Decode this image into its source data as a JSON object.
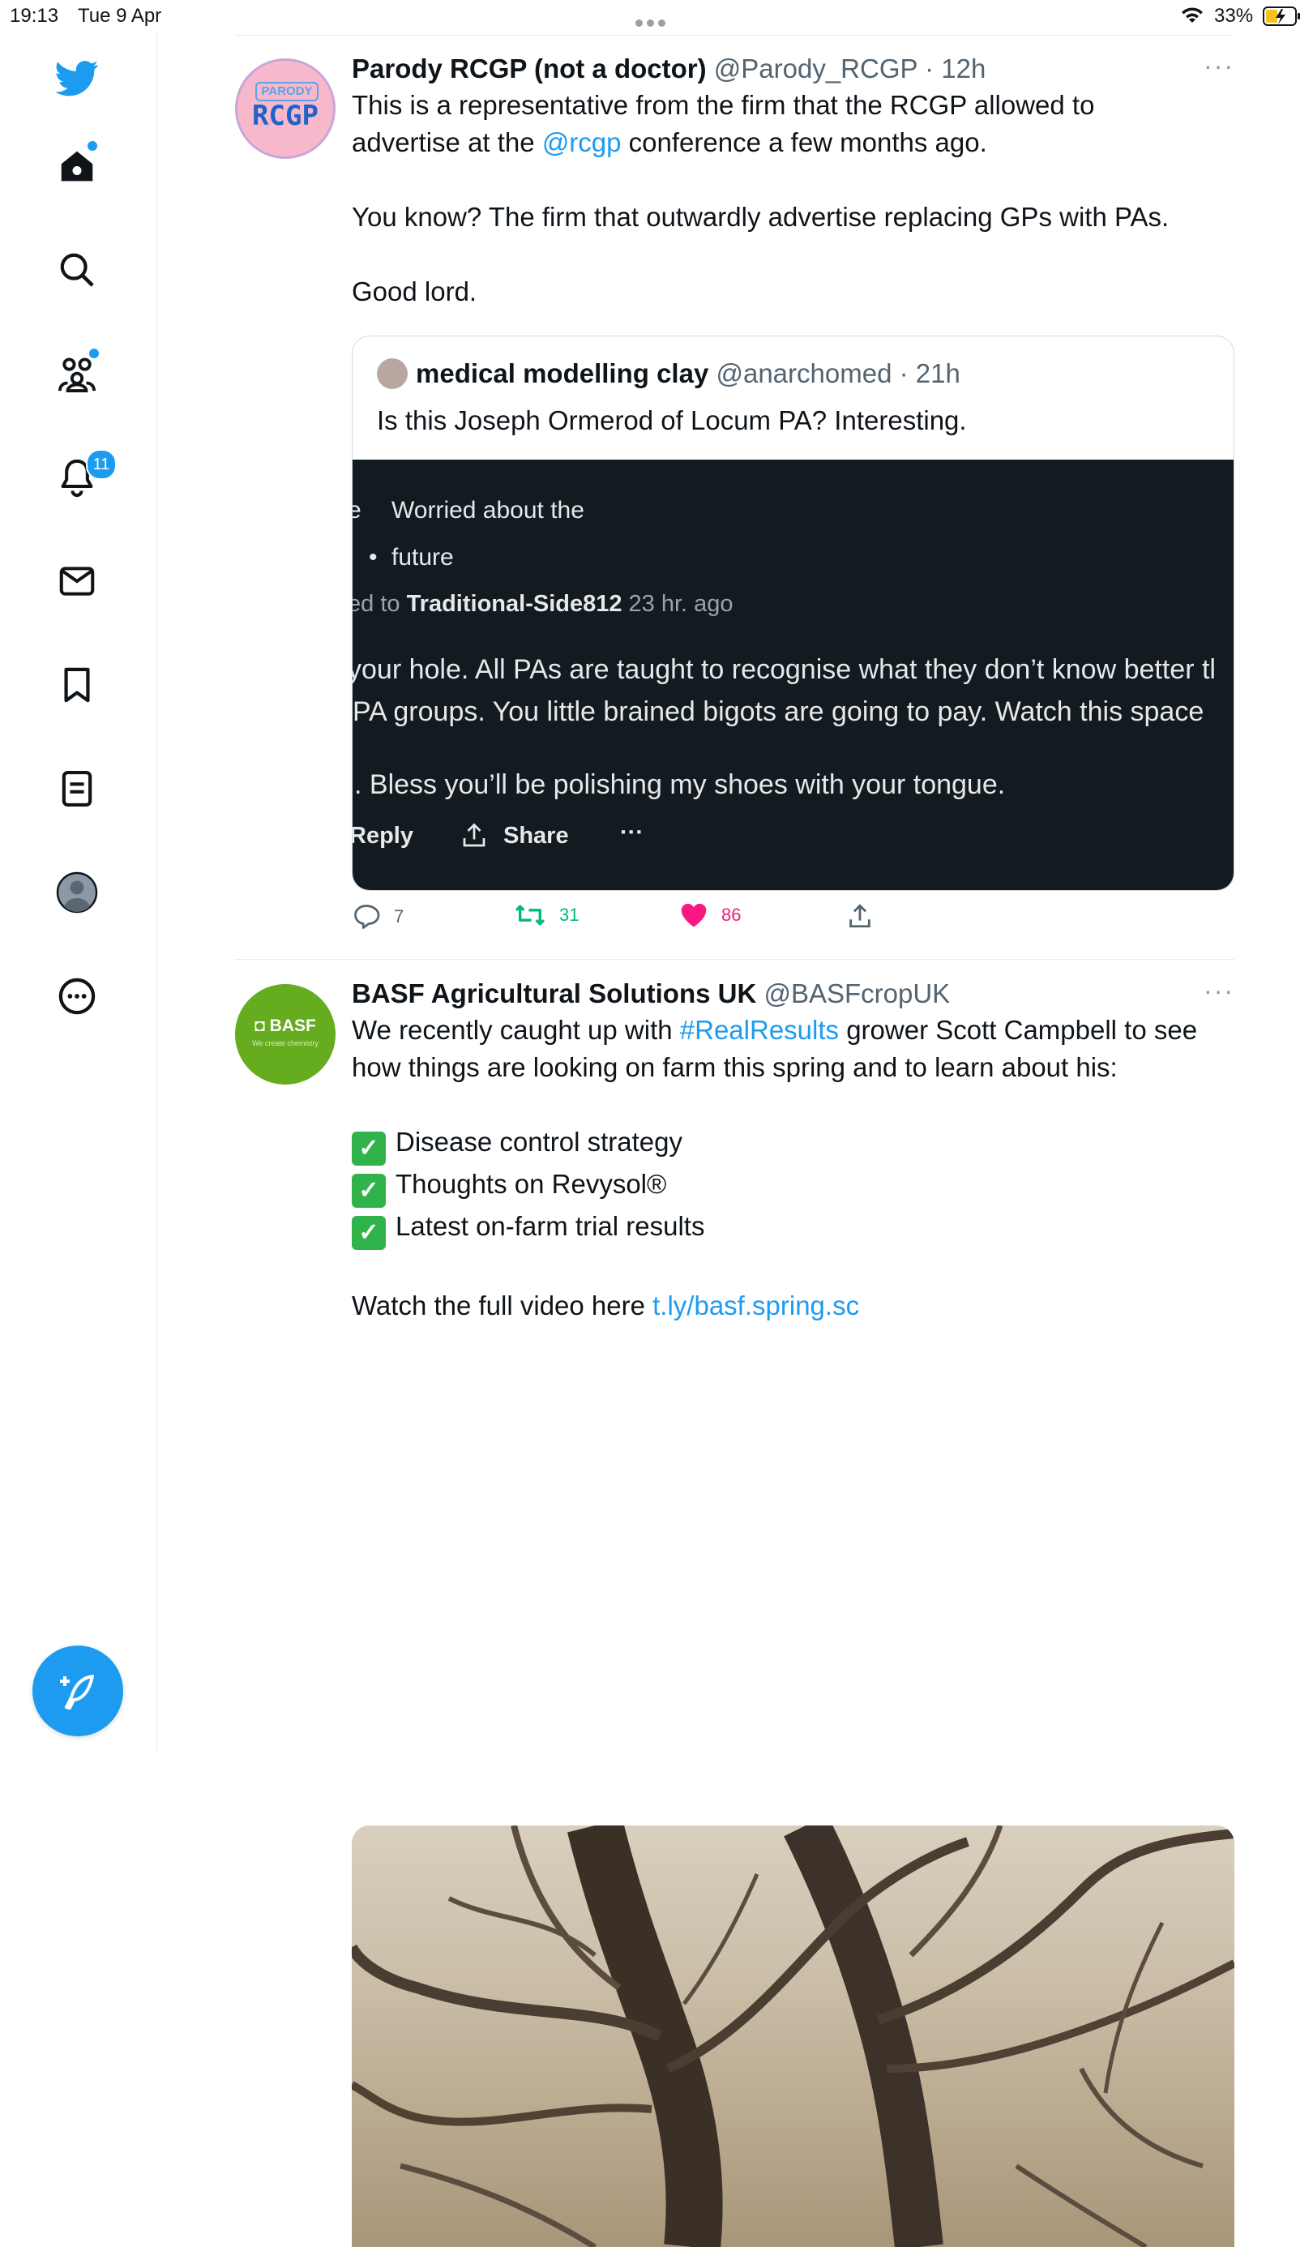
{
  "status_bar": {
    "time": "19:13",
    "date": "Tue 9 Apr",
    "battery_percent": "33%",
    "wifi_icon": "wifi-icon",
    "battery_icon": "battery-charging-icon"
  },
  "sidebar": {
    "items": [
      {
        "name": "twitter-logo-icon"
      },
      {
        "name": "home-icon"
      },
      {
        "name": "search-icon"
      },
      {
        "name": "communities-icon"
      },
      {
        "name": "notifications-icon",
        "badge": "11"
      },
      {
        "name": "messages-icon"
      },
      {
        "name": "bookmarks-icon"
      },
      {
        "name": "lists-icon"
      },
      {
        "name": "profile-icon"
      },
      {
        "name": "more-icon"
      }
    ],
    "compose_icon": "compose-icon",
    "accent_color": "#1d9bf0"
  },
  "tweets": [
    {
      "avatar_text_top": "PARODY",
      "avatar_text_main": "RCGP",
      "name": "Parody RCGP (not a doctor)",
      "handle": "@Parody_RCGP",
      "time": "12h",
      "text_line1_a": "This is a representative from the firm that the RCGP allowed to",
      "text_line2_a": "advertise at the ",
      "text_line2_link": "@rcgp",
      "text_line2_b": " conference a few months ago.",
      "text_para2": "You know? The firm that outwardly advertise replacing GPs with PAs.",
      "text_para3": "Good lord.",
      "quote": {
        "name": "medical modelling clay",
        "handle": "@anarchomed",
        "time": "21h",
        "text": "Is this Joseph Ormerod of Locum PA? Interesting.",
        "image_text": {
          "line1_prefix": "e",
          "line1": "Worried about the",
          "line2_bullet": "•",
          "line2": "future",
          "line3_prefix": "ed to ",
          "line3_user": "Traditional-Side812",
          "line3_time": " 23 hr. ago",
          "line4": "your hole. All PAs are taught to recognise what they don’t know better tl",
          "line5": " PA groups. You little brained bigots are going to pay. Watch this space",
          "line6": ". Bless you’ll be polishing my shoes with your tongue.",
          "reply": "Reply",
          "share": "Share",
          "more": "···"
        }
      },
      "replies": "7",
      "retweets": "31",
      "likes": "86"
    },
    {
      "avatar_text_main": "◘ BASF",
      "avatar_text_sub": "We create chemistry",
      "name": "BASF Agricultural Solutions UK",
      "handle": "@BASFcropUK",
      "text_line1_a": "We recently caught up with ",
      "text_line1_link": "#RealResults",
      "text_line1_b": " grower Scott Campbell to see",
      "text_line2": "how things are looking on farm this spring and to learn about his:",
      "check_mark": "✓",
      "list": [
        "Disease control strategy",
        "Thoughts on Revysol®",
        "Latest on-farm trial results"
      ],
      "watch_text": "Watch the full video here ",
      "watch_link": "t.ly/basf.spring.sc"
    }
  ],
  "more_glyph": "···",
  "dot_sep": " · "
}
